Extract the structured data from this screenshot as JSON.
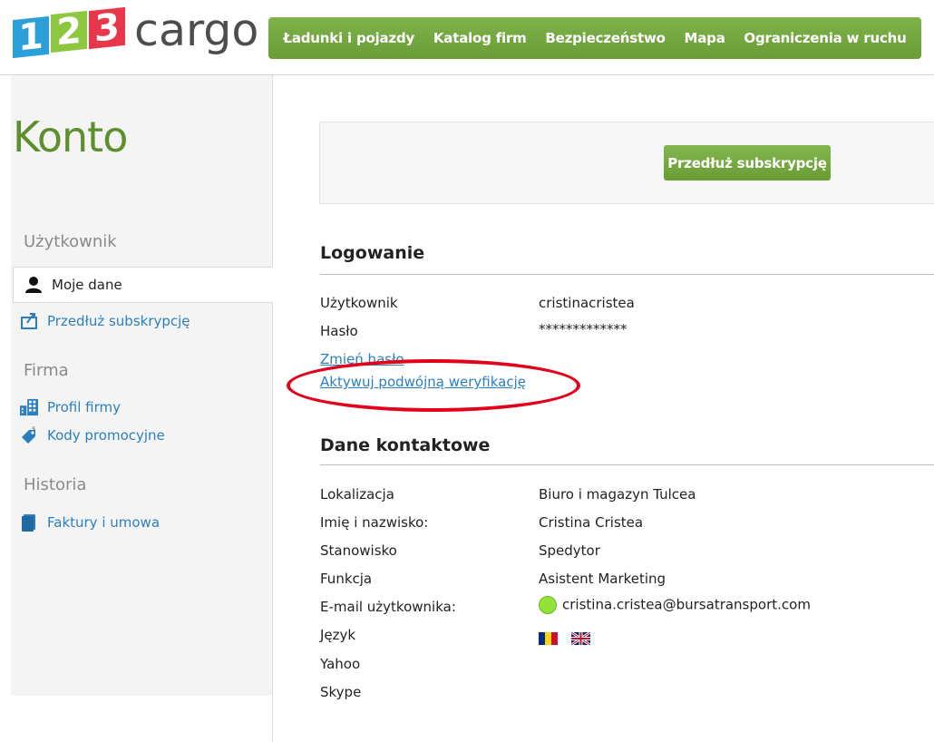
{
  "logo": {
    "digits": [
      "1",
      "2",
      "3"
    ],
    "text": "cargo"
  },
  "nav": [
    "Ładunki i pojazdy",
    "Katalog firm",
    "Bezpieczeństwo",
    "Mapa",
    "Ograniczenia w ruchu"
  ],
  "sidebar": {
    "title": "Konto",
    "sections": {
      "user": "Użytkownik",
      "company": "Firma",
      "history": "Historia"
    },
    "items": {
      "my_data": "Moje dane",
      "extend": "Przedłuż subskrypcję",
      "company_profile": "Profil firmy",
      "promo_codes": "Kody promocyjne",
      "invoices": "Faktury i umowa"
    }
  },
  "promo": {
    "button": "Przedłuż subskrypcję"
  },
  "login": {
    "heading": "Logowanie",
    "user_label": "Użytkownik",
    "user_value": "cristinacristea",
    "password_label": "Hasło",
    "password_value": "*************",
    "change_password": "Zmień hasło",
    "two_factor": "Aktywuj podwójną weryfikację"
  },
  "contact": {
    "heading": "Dane kontaktowe",
    "rows": [
      {
        "label": "Lokalizacja",
        "value": "Biuro i magazyn Tulcea"
      },
      {
        "label": "Imię i nazwisko:",
        "value": "Cristina Cristea"
      },
      {
        "label": "Stanowisko",
        "value": "Spedytor"
      },
      {
        "label": "Funkcja",
        "value": "Asistent Marketing"
      },
      {
        "label": "E-mail użytkownika:",
        "value": "cristina.cristea@bursatransport.com"
      },
      {
        "label": "Język",
        "value": ""
      },
      {
        "label": "Yahoo",
        "value": ""
      },
      {
        "label": "Skype",
        "value": ""
      }
    ],
    "languages": [
      "romania-flag-icon",
      "uk-flag-icon"
    ]
  },
  "colors": {
    "brand_green": "#6a9c37",
    "link": "#2b7fbf",
    "highlight": "#e3001b",
    "online": "#92e337"
  }
}
